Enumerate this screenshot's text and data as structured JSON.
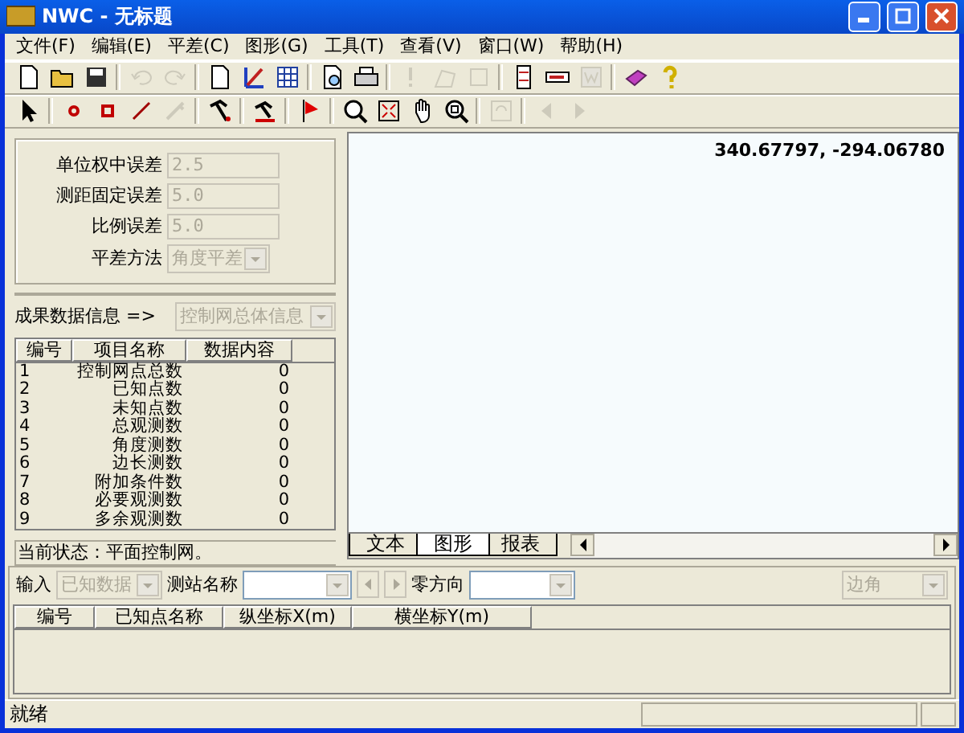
{
  "window": {
    "title": "NWC - 无标题"
  },
  "menu": [
    "文件(F)",
    "编辑(E)",
    "平差(C)",
    "图形(G)",
    "工具(T)",
    "查看(V)",
    "窗口(W)",
    "帮助(H)"
  ],
  "toolbar_1": [
    {
      "kind": "new",
      "disabled": false
    },
    {
      "kind": "open",
      "disabled": false
    },
    {
      "kind": "save",
      "disabled": false
    },
    {
      "kind": "sep"
    },
    {
      "kind": "undo",
      "disabled": true
    },
    {
      "kind": "redo",
      "disabled": true
    },
    {
      "kind": "sep"
    },
    {
      "kind": "page",
      "disabled": false
    },
    {
      "kind": "chart",
      "disabled": false
    },
    {
      "kind": "table",
      "disabled": false
    },
    {
      "kind": "sep"
    },
    {
      "kind": "preview",
      "disabled": false
    },
    {
      "kind": "print",
      "disabled": false
    },
    {
      "kind": "sep"
    },
    {
      "kind": "exclaim",
      "disabled": true
    },
    {
      "kind": "net",
      "disabled": true
    },
    {
      "kind": "frame",
      "disabled": true
    },
    {
      "kind": "sep"
    },
    {
      "kind": "panel",
      "disabled": false
    },
    {
      "kind": "bar",
      "disabled": false
    },
    {
      "kind": "word",
      "disabled": true
    },
    {
      "kind": "sep"
    },
    {
      "kind": "book",
      "disabled": false
    },
    {
      "kind": "help",
      "disabled": false
    }
  ],
  "toolbar_2": [
    {
      "kind": "pointer",
      "disabled": false
    },
    {
      "kind": "sep"
    },
    {
      "kind": "point",
      "disabled": false
    },
    {
      "kind": "square",
      "disabled": false
    },
    {
      "kind": "line",
      "disabled": false
    },
    {
      "kind": "pen",
      "disabled": true
    },
    {
      "kind": "sep"
    },
    {
      "kind": "hammer",
      "disabled": false
    },
    {
      "kind": "sep"
    },
    {
      "kind": "hammer2",
      "disabled": false
    },
    {
      "kind": "sep"
    },
    {
      "kind": "flag",
      "disabled": false
    },
    {
      "kind": "sep"
    },
    {
      "kind": "zoomin",
      "disabled": false
    },
    {
      "kind": "fit",
      "disabled": false
    },
    {
      "kind": "hand",
      "disabled": false
    },
    {
      "kind": "zoom",
      "disabled": false
    },
    {
      "kind": "sep"
    },
    {
      "kind": "refresh",
      "disabled": true
    },
    {
      "kind": "sep"
    },
    {
      "kind": "back",
      "disabled": true
    },
    {
      "kind": "forward",
      "disabled": true
    }
  ],
  "parameters": [
    {
      "label": "单位权中误差",
      "value": "2.5",
      "kind": "text",
      "disabled": true
    },
    {
      "label": "测距固定误差",
      "value": "5.0",
      "kind": "text",
      "disabled": true
    },
    {
      "label": "比例误差",
      "value": "5.0",
      "kind": "text",
      "disabled": true
    },
    {
      "label": "平差方法",
      "value": "角度平差",
      "kind": "select",
      "disabled": true
    }
  ],
  "results": {
    "label": "成果数据信息 =>",
    "select": {
      "value": "控制网总体信息",
      "disabled": true
    },
    "columns": [
      "编号",
      "项目名称",
      "数据内容"
    ],
    "rows": [
      [
        "1",
        "控制网点总数",
        "0"
      ],
      [
        "2",
        "已知点数",
        "0"
      ],
      [
        "3",
        "未知点数",
        "0"
      ],
      [
        "4",
        "总观测数",
        "0"
      ],
      [
        "5",
        "角度测数",
        "0"
      ],
      [
        "6",
        "边长测数",
        "0"
      ],
      [
        "7",
        "附加条件数",
        "0"
      ],
      [
        "8",
        "必要观测数",
        "0"
      ],
      [
        "9",
        "多余观测数",
        "0"
      ]
    ],
    "status": "当前状态：平面控制网。"
  },
  "canvas": {
    "coordinates": "340.67797, -294.06780"
  },
  "view_tabs": [
    {
      "label": "文本",
      "selected": false
    },
    {
      "label": "图形",
      "selected": true
    },
    {
      "label": "报表",
      "selected": false
    }
  ],
  "input_bar": {
    "input_label": "输入",
    "input_select": {
      "value": "已知数据",
      "disabled": true
    },
    "station_label": "测站名称",
    "station_select": {
      "disabled": false
    },
    "zero_label": "零方向",
    "zero_select": {
      "disabled": false
    },
    "mode_select": {
      "value": "边角",
      "disabled": true
    }
  },
  "input_table": {
    "columns": [
      "编号",
      "已知点名称",
      "纵坐标X(m)",
      "横坐标Y(m)"
    ]
  },
  "status_bar": "就绪"
}
